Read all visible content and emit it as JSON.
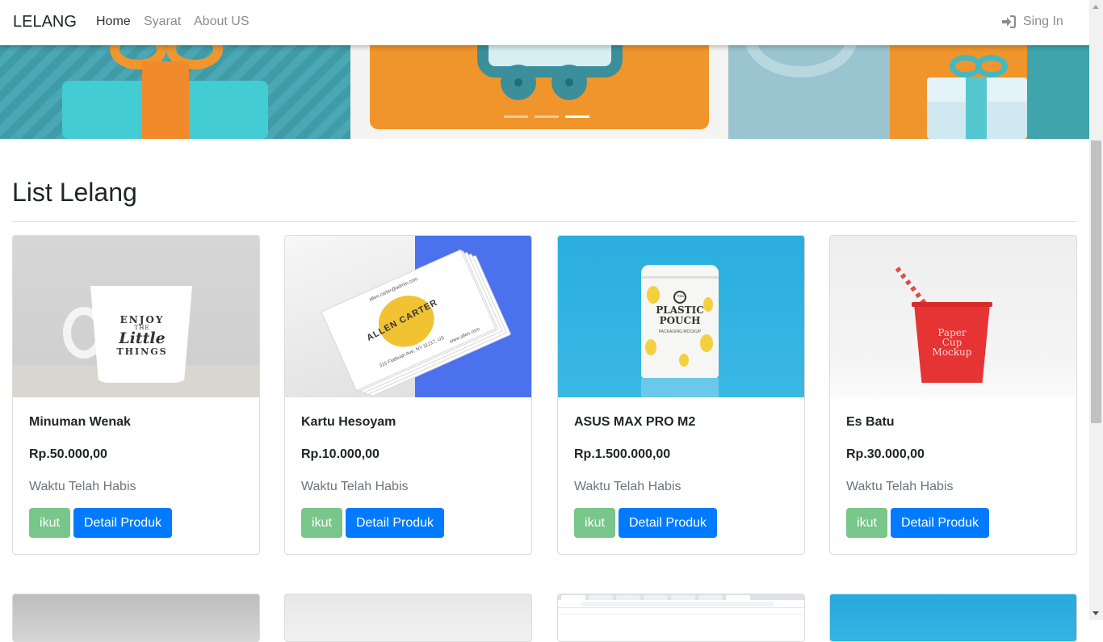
{
  "navbar": {
    "brand": "LELANG",
    "links": [
      "Home",
      "Syarat",
      "About US"
    ],
    "signin_label": "Sing In",
    "signin_icon": "sign-in-icon"
  },
  "carousel": {
    "indicator_count": 3,
    "active_index": 2
  },
  "section": {
    "title": "List Lelang"
  },
  "products": [
    {
      "title": "Minuman Wenak",
      "price": "Rp.50.000,00",
      "status": "Waktu Telah Habis",
      "ikut_label": "ikut",
      "detail_label": "Detail Produk",
      "image_text": [
        "ENJOY",
        "THE",
        "Little",
        "THINGS"
      ]
    },
    {
      "title": "Kartu Hesoyam",
      "price": "Rp.10.000,00",
      "status": "Waktu Telah Habis",
      "ikut_label": "ikut",
      "detail_label": "Detail Produk",
      "image_text": [
        "ALLEN CARTER",
        "allen.carter@admin.com",
        "www.allen.com",
        "315 Flatbush Ave, NY 11217, US"
      ]
    },
    {
      "title": "ASUS MAX PRO M2",
      "price": "Rp.1.500.000,00",
      "status": "Waktu Telah Habis",
      "ikut_label": "ikut",
      "detail_label": "Detail Produk",
      "image_text": [
        "PSD",
        "PLASTIC",
        "POUCH",
        "PACKAGING MOCKUP"
      ]
    },
    {
      "title": "Es Batu",
      "price": "Rp.30.000,00",
      "status": "Waktu Telah Habis",
      "ikut_label": "ikut",
      "detail_label": "Detail Produk",
      "image_text": [
        "Paper",
        "Cup",
        "Mockup"
      ]
    }
  ],
  "colors": {
    "ikut_button": "#78c68a",
    "detail_button": "#007bff",
    "status_text": "#6c757d"
  }
}
